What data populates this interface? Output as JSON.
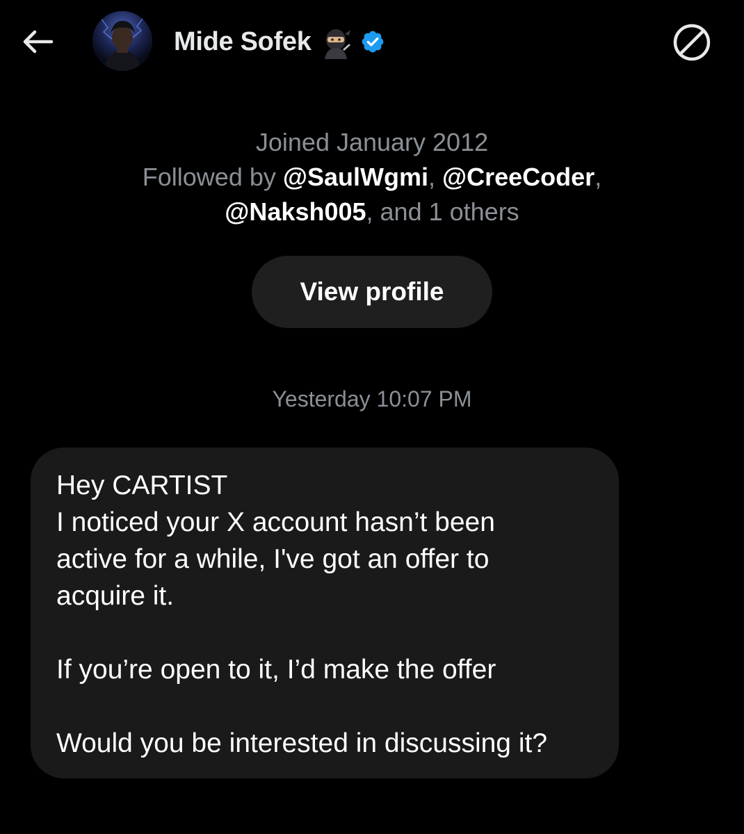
{
  "header": {
    "name": "Mide Sofek",
    "icons": {
      "back": "back-arrow-icon",
      "ninja": "ninja-emoji-icon",
      "verified": "verified-badge-icon",
      "block": "block-icon"
    },
    "verified_color": "#1d9bf0"
  },
  "profile": {
    "joined": "Joined January 2012",
    "followed_prefix": "Followed by",
    "followers": [
      "@SaulWgmi",
      "@CreeCoder",
      "@Naksh005"
    ],
    "sep1": ",",
    "sep2": ",",
    "others_suffix": ", and 1 others"
  },
  "view_profile_label": "View profile",
  "conversation": {
    "timestamp": "Yesterday 10:07 PM",
    "message": {
      "lines": [
        "Hey CARTIST",
        "I noticed your X account hasn’t been",
        "active for a while, I've got an offer to",
        "acquire it."
      ],
      "line2": "If you’re open to it, I’d make the offer",
      "line3": "Would you be interested in discussing it?"
    }
  },
  "colors": {
    "background": "#000000",
    "muted_text": "#8b9096",
    "bubble": "#1a1a1a",
    "button": "#1f1f1f"
  }
}
